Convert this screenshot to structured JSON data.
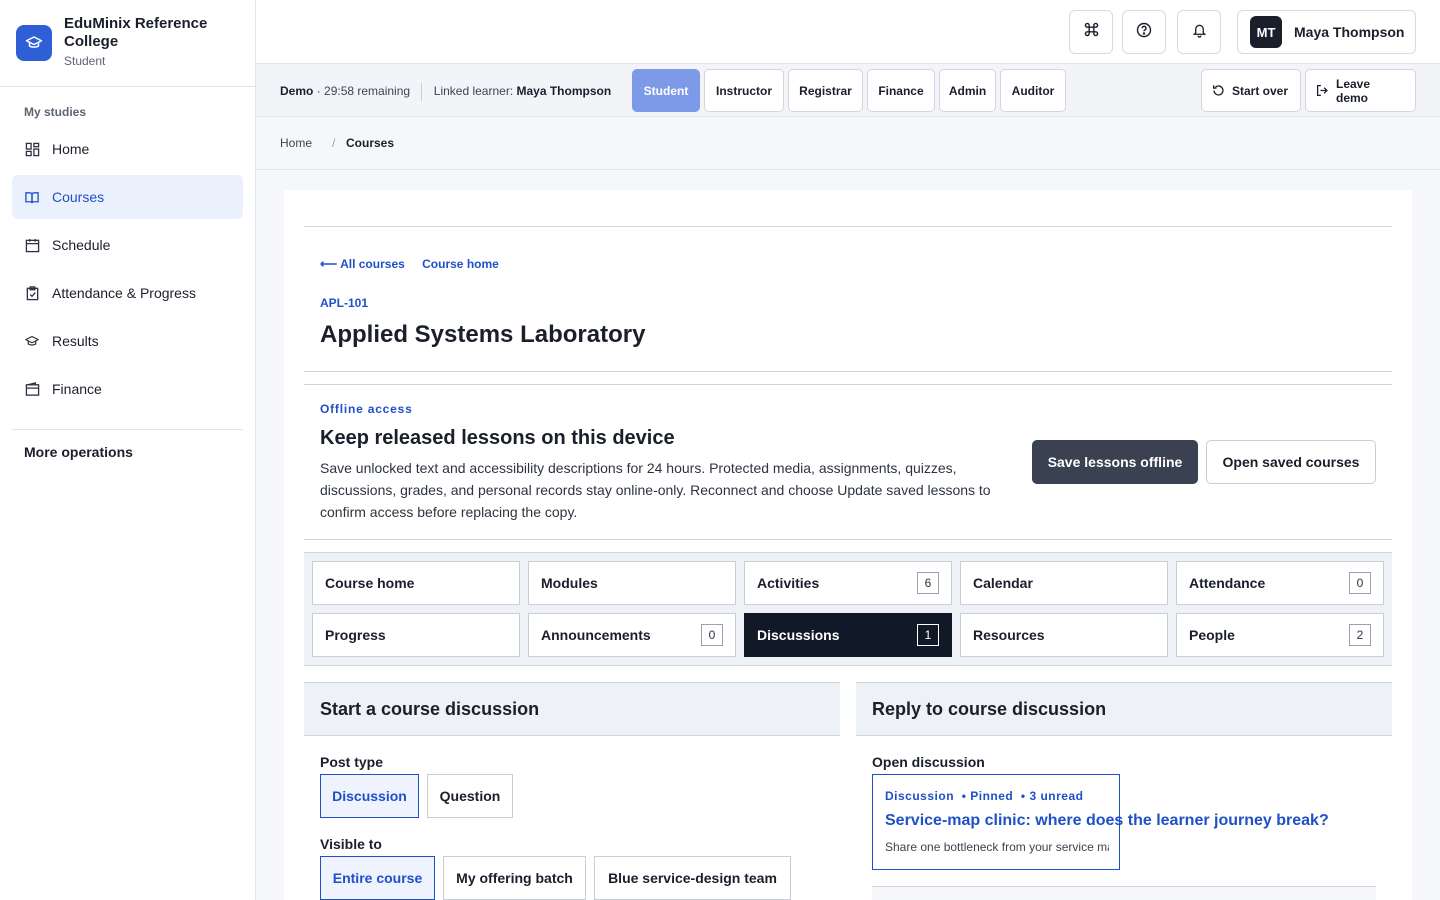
{
  "brand": {
    "name": "EduMinix Reference College",
    "role": "Student"
  },
  "sidebar": {
    "group_title": "My studies",
    "items": [
      {
        "label": "Home",
        "icon": "dashboard-icon",
        "active": false
      },
      {
        "label": "Courses",
        "icon": "book-icon",
        "active": true
      },
      {
        "label": "Schedule",
        "icon": "calendar-icon",
        "active": false
      },
      {
        "label": "Attendance & Progress",
        "icon": "clipboard-check-icon",
        "active": false
      },
      {
        "label": "Results",
        "icon": "graduation-cap-icon",
        "active": false
      },
      {
        "label": "Finance",
        "icon": "wallet-icon",
        "active": false
      }
    ],
    "more": "More operations"
  },
  "topbar": {
    "icons": [
      "command-icon",
      "help-icon",
      "bell-icon"
    ],
    "user": {
      "initials": "MT",
      "name": "Maya Thompson"
    }
  },
  "demo": {
    "label": "Demo",
    "remaining": "· 29:58 remaining",
    "learner_prefix": "Linked learner:",
    "learner_name": "Maya Thompson",
    "roles": [
      "Student",
      "Instructor",
      "Registrar",
      "Finance",
      "Admin",
      "Auditor"
    ],
    "active_role": "Student",
    "start_over": "Start over",
    "leave": "Leave demo"
  },
  "breadcrumb": {
    "home": "Home",
    "sep": "/",
    "current": "Courses"
  },
  "course": {
    "back_all": "⟵ All courses",
    "back_home": "Course home",
    "code": "APL-101",
    "title": "Applied Systems Laboratory"
  },
  "offline": {
    "eyebrow": "Offline access",
    "title": "Keep released lessons on this device",
    "description": "Save unlocked text and accessibility descriptions for 24 hours. Protected media, assignments, quizzes, discussions, grades, and personal records stay online-only. Reconnect and choose Update saved lessons to confirm access before replacing the copy.",
    "save_button": "Save lessons offline",
    "open_button": "Open saved courses"
  },
  "tabs": [
    {
      "label": "Course home",
      "count": null
    },
    {
      "label": "Modules",
      "count": null
    },
    {
      "label": "Activities",
      "count": "6"
    },
    {
      "label": "Calendar",
      "count": null
    },
    {
      "label": "Attendance",
      "count": "0"
    },
    {
      "label": "Progress",
      "count": null
    },
    {
      "label": "Announcements",
      "count": "0"
    },
    {
      "label": "Discussions",
      "count": "1"
    },
    {
      "label": "Resources",
      "count": null
    },
    {
      "label": "People",
      "count": "2"
    }
  ],
  "start_discussion": {
    "title": "Start a course discussion",
    "post_type_label": "Post type",
    "post_types": [
      "Discussion",
      "Question"
    ],
    "visible_label": "Visible to",
    "visibility": [
      "Entire course",
      "My offering batch",
      "Blue service-design team"
    ]
  },
  "reply": {
    "title": "Reply to course discussion",
    "open_label": "Open discussion",
    "discussion": {
      "type": "Discussion",
      "pinned": "• Pinned",
      "unread": "• 3 unread",
      "title": "Service-map clinic: where does the learner journey break?",
      "snippet": "Share one bottleneck from your service map"
    }
  }
}
